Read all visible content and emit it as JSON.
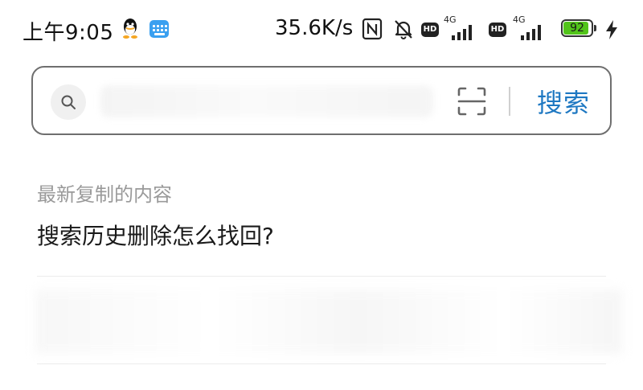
{
  "status_bar": {
    "time": "上午9:05",
    "net_speed": "35.6K/s",
    "sim1": {
      "badge": "HD",
      "network": "4G"
    },
    "sim2": {
      "badge": "HD",
      "network": "4G"
    },
    "battery_level": "92",
    "battery_color": "#52c41a",
    "icons": [
      "qq-icon",
      "keyboard-icon",
      "nfc-icon",
      "bell-muted-icon",
      "signal-icon",
      "battery-icon",
      "charging-bolt-icon"
    ]
  },
  "search": {
    "placeholder": "",
    "value": "",
    "button_label": "搜索",
    "accent_color": "#1e78c2",
    "icons": [
      "search-icon",
      "scan-icon"
    ]
  },
  "clipboard": {
    "title": "最新复制的内容",
    "content": "搜索历史删除怎么找回?"
  }
}
